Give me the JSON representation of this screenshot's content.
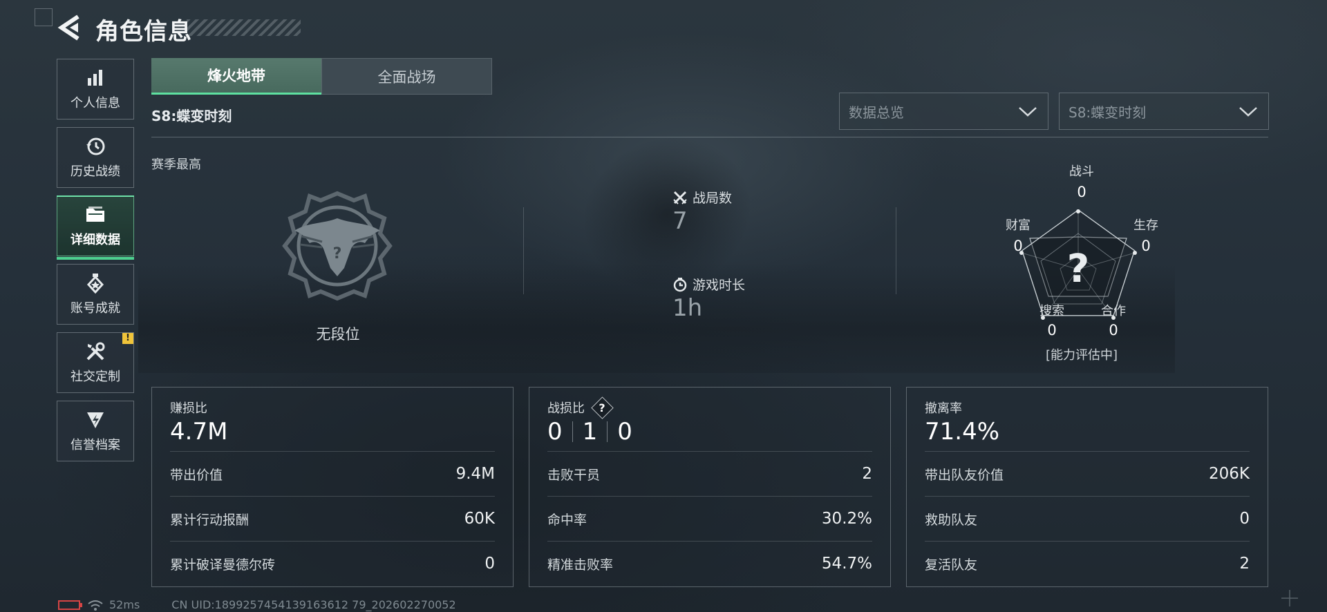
{
  "header": {
    "title": "角色信息"
  },
  "sidebar": {
    "items": [
      {
        "label": "个人信息",
        "icon": "bar-chart-icon"
      },
      {
        "label": "历史战绩",
        "icon": "history-clock-icon"
      },
      {
        "label": "详细数据",
        "icon": "folder-icon",
        "active": true
      },
      {
        "label": "账号成就",
        "icon": "medal-icon"
      },
      {
        "label": "社交定制",
        "icon": "tools-icon",
        "badge": "!"
      },
      {
        "label": "信誉档案",
        "icon": "shield-bolt-icon"
      }
    ]
  },
  "tabs": [
    {
      "label": "烽火地带",
      "active": true
    },
    {
      "label": "全面战场",
      "active": false
    }
  ],
  "season": {
    "label": "S8:蝶变时刻"
  },
  "filters": {
    "view": {
      "value": "数据总览"
    },
    "season": {
      "value": "S8:蝶变时刻"
    }
  },
  "overview": {
    "section_label": "赛季最高",
    "rank": {
      "text": "无段位",
      "emblem_mark": "?"
    },
    "matches": {
      "label": "战局数",
      "value": "7"
    },
    "playtime": {
      "label": "游戏时长",
      "value": "1h"
    },
    "radar": {
      "center_mark": "?",
      "axes": [
        {
          "label": "战斗",
          "value": "0"
        },
        {
          "label": "生存",
          "value": "0"
        },
        {
          "label": "合作",
          "value": "0"
        },
        {
          "label": "搜索",
          "value": "0"
        },
        {
          "label": "财富",
          "value": "0"
        }
      ],
      "footer": "[能力评估中]"
    }
  },
  "cards": {
    "profit": {
      "title": "赚损比",
      "big": "4.7M",
      "rows": [
        {
          "label": "带出价值",
          "value": "9.4M"
        },
        {
          "label": "累计行动报酬",
          "value": "60K"
        },
        {
          "label": "累计破译曼德尔砖",
          "value": "0"
        }
      ]
    },
    "kd": {
      "title": "战损比",
      "help": "?",
      "kd_values": [
        "0",
        "1",
        "0"
      ],
      "rows": [
        {
          "label": "击败干员",
          "value": "2"
        },
        {
          "label": "命中率",
          "value": "30.2%"
        },
        {
          "label": "精准击败率",
          "value": "54.7%"
        }
      ]
    },
    "extract": {
      "title": "撤离率",
      "big": "71.4%",
      "rows": [
        {
          "label": "带出队友价值",
          "value": "206K"
        },
        {
          "label": "救助队友",
          "value": "0"
        },
        {
          "label": "复活队友",
          "value": "2"
        }
      ]
    }
  },
  "footer": {
    "ping": "52ms",
    "uid": "CN UID:1899257454139163612 79_202602270052"
  },
  "colors": {
    "accent": "#4dd08f",
    "battery": "#d64545",
    "badge": "#f0c43a"
  }
}
